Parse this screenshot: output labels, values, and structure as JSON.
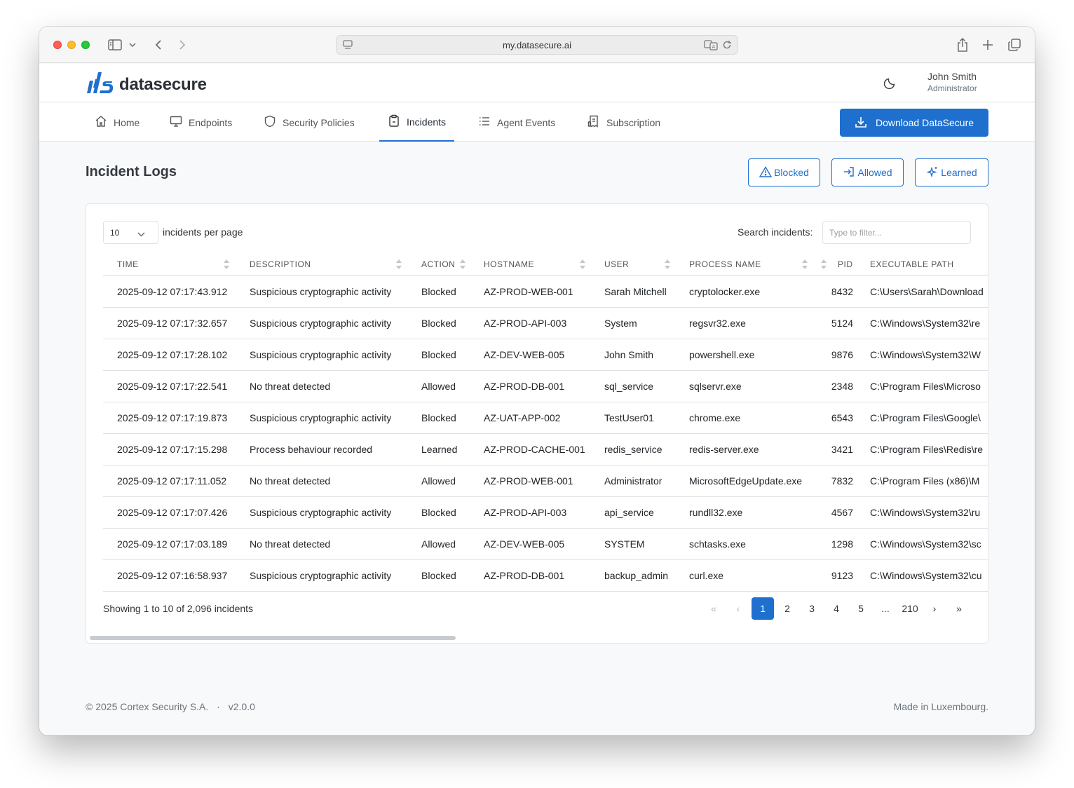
{
  "browser": {
    "url": "my.datasecure.ai"
  },
  "brand": {
    "name": "datasecure",
    "accent": "#1e6fce"
  },
  "user": {
    "name": "John Smith",
    "role": "Administrator"
  },
  "nav": {
    "items": [
      {
        "label": "Home",
        "icon": "home-icon"
      },
      {
        "label": "Endpoints",
        "icon": "monitor-icon"
      },
      {
        "label": "Security Policies",
        "icon": "shield-icon"
      },
      {
        "label": "Incidents",
        "icon": "clipboard-icon",
        "active": true
      },
      {
        "label": "Agent Events",
        "icon": "list-icon"
      },
      {
        "label": "Subscription",
        "icon": "receipt-icon"
      }
    ],
    "download_label": "Download DataSecure"
  },
  "page": {
    "title": "Incident Logs",
    "filters": {
      "blocked": "Blocked",
      "allowed": "Allowed",
      "learned": "Learned"
    }
  },
  "table": {
    "per_page_value": "10",
    "per_page_label": "incidents per page",
    "search_label": "Search incidents:",
    "search_placeholder": "Type to filter...",
    "columns": {
      "time": "TIME",
      "description": "DESCRIPTION",
      "action": "ACTION",
      "hostname": "HOSTNAME",
      "user": "USER",
      "process": "PROCESS NAME",
      "pid": "PID",
      "path": "EXECUTABLE PATH"
    },
    "rows": [
      {
        "time": "2025-09-12 07:17:43.912",
        "description": "Suspicious cryptographic activity",
        "action": "Blocked",
        "hostname": "AZ-PROD-WEB-001",
        "user": "Sarah Mitchell",
        "process": "cryptolocker.exe",
        "pid": "8432",
        "path": "C:\\Users\\Sarah\\Download"
      },
      {
        "time": "2025-09-12 07:17:32.657",
        "description": "Suspicious cryptographic activity",
        "action": "Blocked",
        "hostname": "AZ-PROD-API-003",
        "user": "System",
        "process": "regsvr32.exe",
        "pid": "5124",
        "path": "C:\\Windows\\System32\\re"
      },
      {
        "time": "2025-09-12 07:17:28.102",
        "description": "Suspicious cryptographic activity",
        "action": "Blocked",
        "hostname": "AZ-DEV-WEB-005",
        "user": "John Smith",
        "process": "powershell.exe",
        "pid": "9876",
        "path": "C:\\Windows\\System32\\W"
      },
      {
        "time": "2025-09-12 07:17:22.541",
        "description": "No threat detected",
        "action": "Allowed",
        "hostname": "AZ-PROD-DB-001",
        "user": "sql_service",
        "process": "sqlservr.exe",
        "pid": "2348",
        "path": "C:\\Program Files\\Microso"
      },
      {
        "time": "2025-09-12 07:17:19.873",
        "description": "Suspicious cryptographic activity",
        "action": "Blocked",
        "hostname": "AZ-UAT-APP-002",
        "user": "TestUser01",
        "process": "chrome.exe",
        "pid": "6543",
        "path": "C:\\Program Files\\Google\\"
      },
      {
        "time": "2025-09-12 07:17:15.298",
        "description": "Process behaviour recorded",
        "action": "Learned",
        "hostname": "AZ-PROD-CACHE-001",
        "user": "redis_service",
        "process": "redis-server.exe",
        "pid": "3421",
        "path": "C:\\Program Files\\Redis\\re"
      },
      {
        "time": "2025-09-12 07:17:11.052",
        "description": "No threat detected",
        "action": "Allowed",
        "hostname": "AZ-PROD-WEB-001",
        "user": "Administrator",
        "process": "MicrosoftEdgeUpdate.exe",
        "pid": "7832",
        "path": "C:\\Program Files (x86)\\M"
      },
      {
        "time": "2025-09-12 07:17:07.426",
        "description": "Suspicious cryptographic activity",
        "action": "Blocked",
        "hostname": "AZ-PROD-API-003",
        "user": "api_service",
        "process": "rundll32.exe",
        "pid": "4567",
        "path": "C:\\Windows\\System32\\ru"
      },
      {
        "time": "2025-09-12 07:17:03.189",
        "description": "No threat detected",
        "action": "Allowed",
        "hostname": "AZ-DEV-WEB-005",
        "user": "SYSTEM",
        "process": "schtasks.exe",
        "pid": "1298",
        "path": "C:\\Windows\\System32\\sc"
      },
      {
        "time": "2025-09-12 07:16:58.937",
        "description": "Suspicious cryptographic activity",
        "action": "Blocked",
        "hostname": "AZ-PROD-DB-001",
        "user": "backup_admin",
        "process": "curl.exe",
        "pid": "9123",
        "path": "C:\\Windows\\System32\\cu"
      }
    ],
    "showing": "Showing 1 to 10 of 2,096 incidents",
    "pagination": {
      "first": "«",
      "prev": "‹",
      "pages": [
        "1",
        "2",
        "3",
        "4",
        "5",
        "...",
        "210"
      ],
      "next": "›",
      "last": "»"
    }
  },
  "footer": {
    "copyright": "© 2025 Cortex Security S.A.",
    "separator": "·",
    "version": "v2.0.0",
    "made_in": "Made in Luxembourg."
  }
}
